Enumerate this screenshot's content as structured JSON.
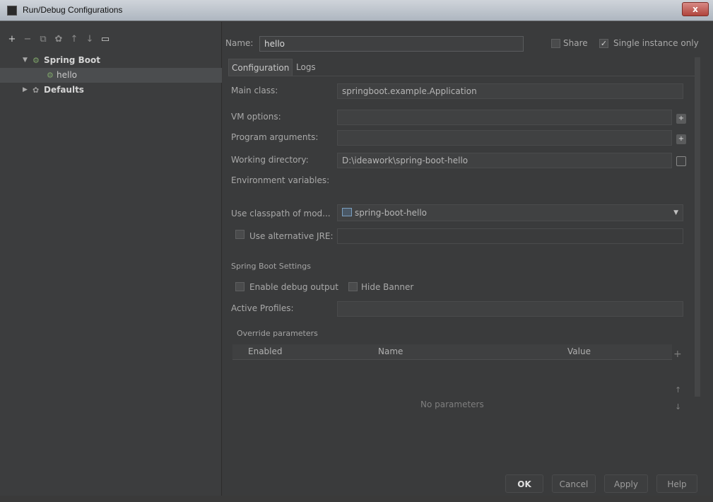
{
  "window": {
    "title": "Run/Debug Configurations",
    "close_label": "x"
  },
  "toolbar": {
    "icons": [
      "plus-icon",
      "minus-icon",
      "copy-icon",
      "share-icon",
      "move-up-icon",
      "move-down-icon",
      "folder-icon"
    ]
  },
  "tree": {
    "spring_boot": "Spring Boot",
    "hello": "hello",
    "defaults": "Defaults"
  },
  "header": {
    "name_label": "Name:",
    "name_value": "hello",
    "share_label": "Share",
    "share_checked": false,
    "single_instance_label": "Single instance only",
    "single_instance_checked": true
  },
  "tabs": {
    "configuration": "Configuration",
    "logs": "Logs"
  },
  "config": {
    "main_class_label": "Main class:",
    "main_class_value": "springboot.example.Application",
    "vm_options_label": "VM options:",
    "vm_options_value": "",
    "program_args_label": "Program arguments:",
    "program_args_value": "",
    "working_dir_label": "Working directory:",
    "working_dir_value": "D:\\ideawork\\spring-boot-hello",
    "env_vars_label": "Environment variables:",
    "env_vars_value": "",
    "classpath_label": "Use classpath of mod...",
    "classpath_value": "spring-boot-hello",
    "alt_jre_label": "Use alternative JRE:",
    "alt_jre_value": ""
  },
  "spring_boot_settings": {
    "section_title": "Spring Boot Settings",
    "debug_output_label": "Enable debug output",
    "hide_banner_label": "Hide Banner",
    "active_profiles_label": "Active Profiles:",
    "active_profiles_value": ""
  },
  "override": {
    "section_title": "Override parameters",
    "columns": [
      "Enabled",
      "Name",
      "Value"
    ],
    "empty_text": "No parameters",
    "rows": []
  },
  "buttons": {
    "ok": "OK",
    "cancel": "Cancel",
    "apply": "Apply",
    "help": "Help"
  },
  "colors": {
    "background": "#3a3b3c",
    "accent_green": "#7fa56a"
  }
}
